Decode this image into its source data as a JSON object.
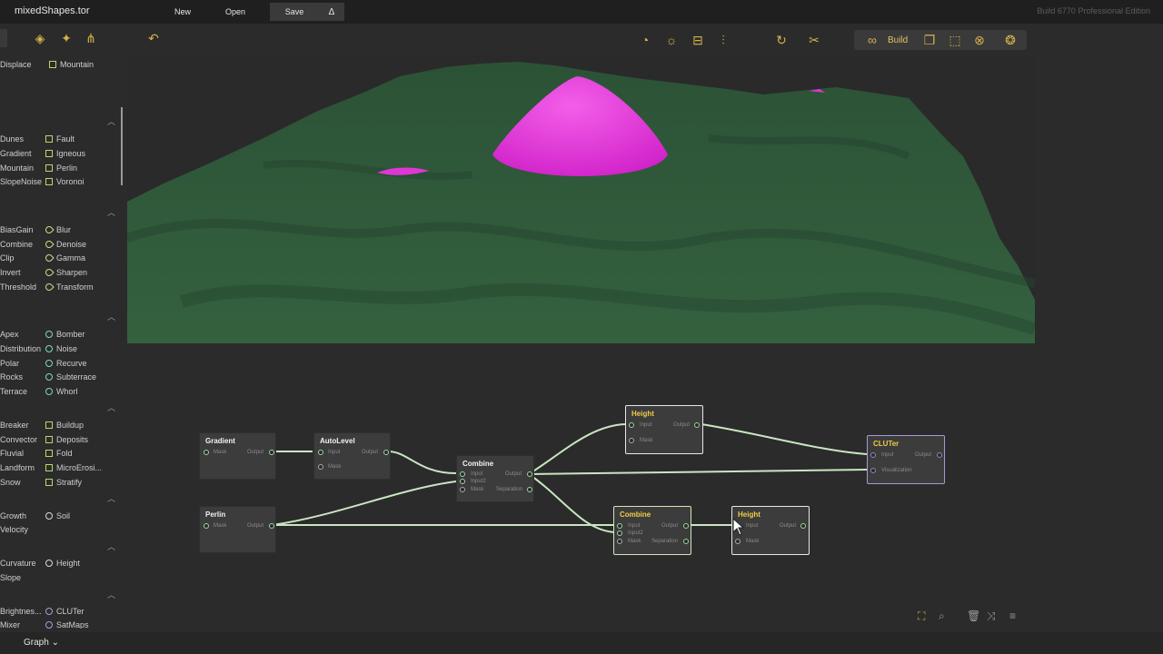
{
  "app": {
    "file_name": "mixedShapes.tor",
    "menu": {
      "new": "New",
      "open": "Open",
      "save": "Save",
      "delta": "Δ"
    },
    "build_info": "Build 6770 Professional Edition"
  },
  "toolbar": {
    "build_label": "Build",
    "left_icons": [
      "diamond-arrow-icon",
      "run-icon",
      "pitchfork-icon",
      "undo-icon"
    ],
    "view_icons": [
      "time-icon",
      "sun-icon",
      "ruler-icon",
      "sliders-icon",
      "refresh-icon",
      "scissors-icon"
    ],
    "build_icons": [
      "link-icon",
      "copy-icon",
      "cube-icon",
      "close-circle-icon",
      "atom-icon"
    ]
  },
  "sidebar": {
    "top_row": [
      "Displace",
      "Mountain"
    ],
    "groups": [
      {
        "left": [
          "Dunes",
          "Gradient",
          "Mountain",
          "SlopeNoise"
        ],
        "right": [
          "Fault",
          "Igneous",
          "Perlin",
          "Voronoi"
        ]
      },
      {
        "left": [
          "BiasGain",
          "Combine",
          "Clip",
          "Invert",
          "Threshold"
        ],
        "right": [
          "Blur",
          "Denoise",
          "Gamma",
          "Sharpen",
          "Transform"
        ]
      },
      {
        "left": [
          "Apex",
          "Distribution",
          "Polar",
          "Rocks",
          "Terrace"
        ],
        "right": [
          "Bomber",
          "Noise",
          "Recurve",
          "Subterrace",
          "Whorl"
        ]
      },
      {
        "left": [
          "Breaker",
          "Convector",
          "Fluvial",
          "Landform",
          "Snow"
        ],
        "right": [
          "Buildup",
          "Deposits",
          "Fold",
          "MicroErosi...",
          "Stratify"
        ]
      },
      {
        "left": [
          "Growth",
          "Velocity"
        ],
        "right": [
          "Soil"
        ]
      },
      {
        "left": [
          "Curvature",
          "Slope"
        ],
        "right": [
          "Height"
        ]
      },
      {
        "left": [
          "Brightnes...",
          "Mixer"
        ],
        "right": [
          "CLUTer",
          "SatMaps"
        ]
      }
    ]
  },
  "graph": {
    "nodes": {
      "gradient": {
        "title": "Gradient",
        "in": "Mask",
        "out": "Output"
      },
      "autolevel": {
        "title": "AutoLevel",
        "in": "Input",
        "mask": "Mask",
        "out": "Output"
      },
      "perlin": {
        "title": "Perlin",
        "in": "Mask",
        "out": "Output"
      },
      "combine1": {
        "title": "Combine",
        "in1": "Input",
        "in2": "Input2",
        "mask": "Mask",
        "out": "Output",
        "sep": "Separation"
      },
      "height1": {
        "title": "Height",
        "in": "Input",
        "mask": "Mask",
        "out": "Output"
      },
      "combine2": {
        "title": "Combine",
        "in1": "Input",
        "in2": "Input2",
        "mask": "Mask",
        "out": "Output",
        "sep": "Separation"
      },
      "height2": {
        "title": "Height",
        "in": "Input",
        "mask": "Mask",
        "out": "Output"
      },
      "cluter": {
        "title": "CLUTer",
        "in": "Input",
        "viz": "Visualization",
        "out": "Output"
      }
    },
    "bottom_icons": [
      "fit-icon",
      "zoom-icon",
      "trash-icon",
      "shuffle-icon",
      "menu-icon"
    ]
  },
  "bottom_bar": {
    "tab": "Graph"
  },
  "colors": {
    "terrain": "#2f5a3a",
    "peak": "#e23ad8",
    "wire": "#c8e6c2",
    "accent": "#d6b14d"
  }
}
